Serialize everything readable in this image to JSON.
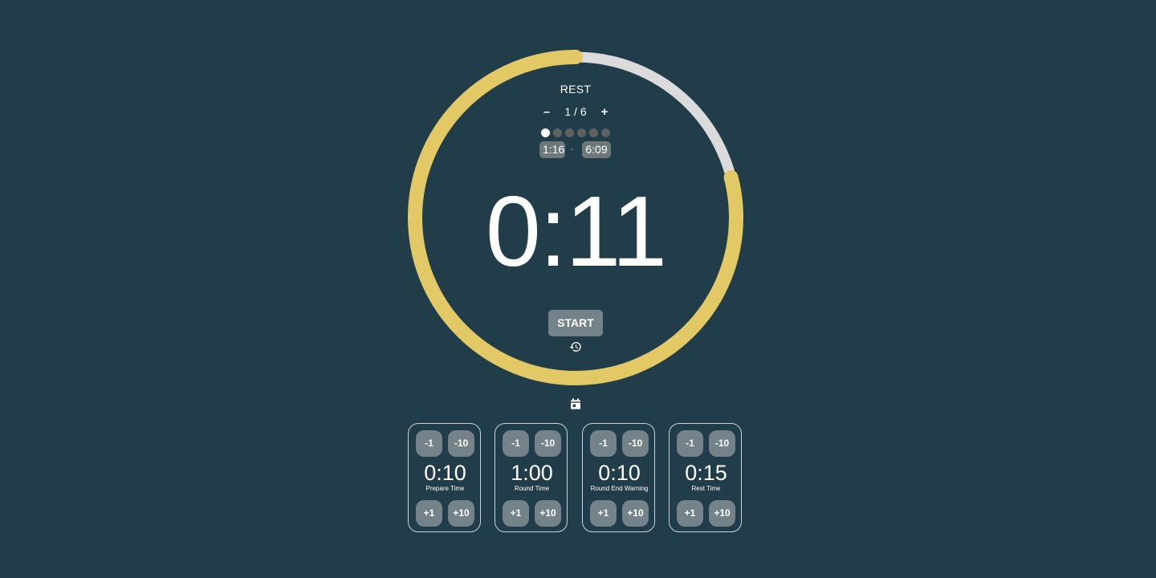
{
  "colors": {
    "background": "#223d4a",
    "ring_progress": "#e3c966",
    "ring_track": "#dbdbdb",
    "button_bg": "#74838a"
  },
  "timer": {
    "phase": "REST",
    "round_minus": "–",
    "round_plus": "+",
    "round_indicator": "1 / 6",
    "rounds_total": 6,
    "rounds_completed": 1,
    "elapsed": "1:16",
    "separator": "-",
    "total": "6:09",
    "display": "0:11",
    "ring_progress_fraction": 0.79,
    "start_label": "START",
    "history_icon": "history-icon",
    "calendar_icon": "calendar-icon"
  },
  "settings": [
    {
      "value": "0:10",
      "label": "Prepare Time",
      "minus1": "-1",
      "minus10": "-10",
      "plus1": "+1",
      "plus10": "+10"
    },
    {
      "value": "1:00",
      "label": "Round Time",
      "minus1": "-1",
      "minus10": "-10",
      "plus1": "+1",
      "plus10": "+10"
    },
    {
      "value": "0:10",
      "label": "Round End Warning",
      "minus1": "-1",
      "minus10": "-10",
      "plus1": "+1",
      "plus10": "+10"
    },
    {
      "value": "0:15",
      "label": "Rest Time",
      "minus1": "-1",
      "minus10": "-10",
      "plus1": "+1",
      "plus10": "+10"
    }
  ]
}
